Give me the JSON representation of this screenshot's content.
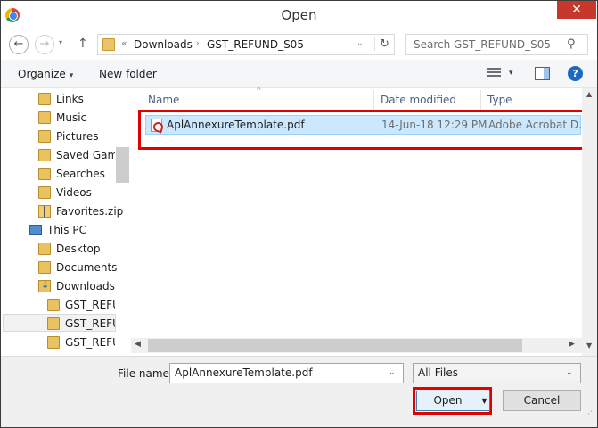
{
  "window": {
    "title": "Open",
    "close_glyph": "✕"
  },
  "nav": {
    "back_glyph": "←",
    "forward_glyph": "→",
    "recent_glyph": "▾",
    "up_glyph": "↑"
  },
  "address": {
    "sep": "«",
    "crumbs": [
      "Downloads",
      "GST_REFUND_S05"
    ],
    "dropdown_glyph": "⌄",
    "refresh_glyph": "↻"
  },
  "search": {
    "placeholder": "Search GST_REFUND_S05",
    "icon_glyph": "⚲"
  },
  "toolbar": {
    "organize": "Organize",
    "new_folder": "New folder",
    "caret": "▾",
    "help": "?"
  },
  "tree": {
    "items": [
      {
        "label": "Links",
        "icon": "folder-icon"
      },
      {
        "label": "Music",
        "icon": "folder-icon"
      },
      {
        "label": "Pictures",
        "icon": "folder-icon"
      },
      {
        "label": "Saved Games",
        "icon": "folder-icon"
      },
      {
        "label": "Searches",
        "icon": "folder-icon"
      },
      {
        "label": "Videos",
        "icon": "folder-icon"
      },
      {
        "label": "Favorites.zip",
        "icon": "zip-icon"
      },
      {
        "label": "This PC",
        "icon": "computer-icon"
      },
      {
        "label": "Desktop",
        "icon": "folder-icon"
      },
      {
        "label": "Documents",
        "icon": "folder-icon"
      },
      {
        "label": "Downloads",
        "icon": "downloads-icon"
      },
      {
        "label": "GST_REFUND",
        "icon": "folder-icon"
      },
      {
        "label": "GST_REFUND",
        "icon": "folder-icon"
      },
      {
        "label": "GST_REFUND",
        "icon": "folder-icon"
      }
    ]
  },
  "columns": {
    "name": "Name",
    "date": "Date modified",
    "type": "Type",
    "sort": "^"
  },
  "files": [
    {
      "name": "AplAnnexureTemplate.pdf",
      "date": "14-Jun-18 12:29 PM",
      "type": "Adobe Acrobat D..."
    }
  ],
  "scroll": {
    "up": "▲",
    "down": "▼",
    "left": "◀",
    "right": "▶"
  },
  "bottom": {
    "file_name_label": "File name:",
    "file_name_value": "AplAnnexureTemplate.pdf",
    "filter_value": "All Files",
    "dropdown_glyph": "⌄",
    "open_label": "Open",
    "open_split_glyph": "▼",
    "cancel_label": "Cancel",
    "grip": "⋰"
  },
  "colors": {
    "highlight": "#e00000",
    "selection": "#cce8ff",
    "close": "#c7372c"
  }
}
